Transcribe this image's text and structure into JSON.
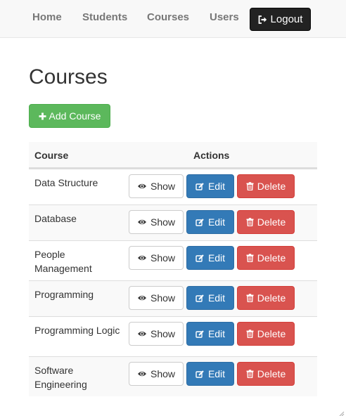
{
  "nav": {
    "items": [
      {
        "label": "Home"
      },
      {
        "label": "Students"
      },
      {
        "label": "Courses"
      },
      {
        "label": "Users"
      }
    ],
    "logout_label": "Logout"
  },
  "page": {
    "title": "Courses",
    "add_button_label": "Add Course"
  },
  "table": {
    "headers": {
      "course": "Course",
      "actions": "Actions"
    },
    "action_labels": {
      "show": "Show",
      "edit": "Edit",
      "delete": "Delete"
    },
    "rows": [
      {
        "name": "Data Structure"
      },
      {
        "name": "Database"
      },
      {
        "name": "People Management"
      },
      {
        "name": "Programming"
      },
      {
        "name": "Programming Logic"
      },
      {
        "name": "Software Engineering"
      }
    ]
  },
  "colors": {
    "success": "#5cb85c",
    "primary": "#337ab7",
    "danger": "#d9534f",
    "navbar_bg": "#f8f8f8",
    "logout_bg": "#222222"
  },
  "icons": {
    "add": "plus-icon",
    "logout": "logout-icon",
    "show": "eye-icon",
    "edit": "edit-icon",
    "delete": "trash-icon"
  }
}
